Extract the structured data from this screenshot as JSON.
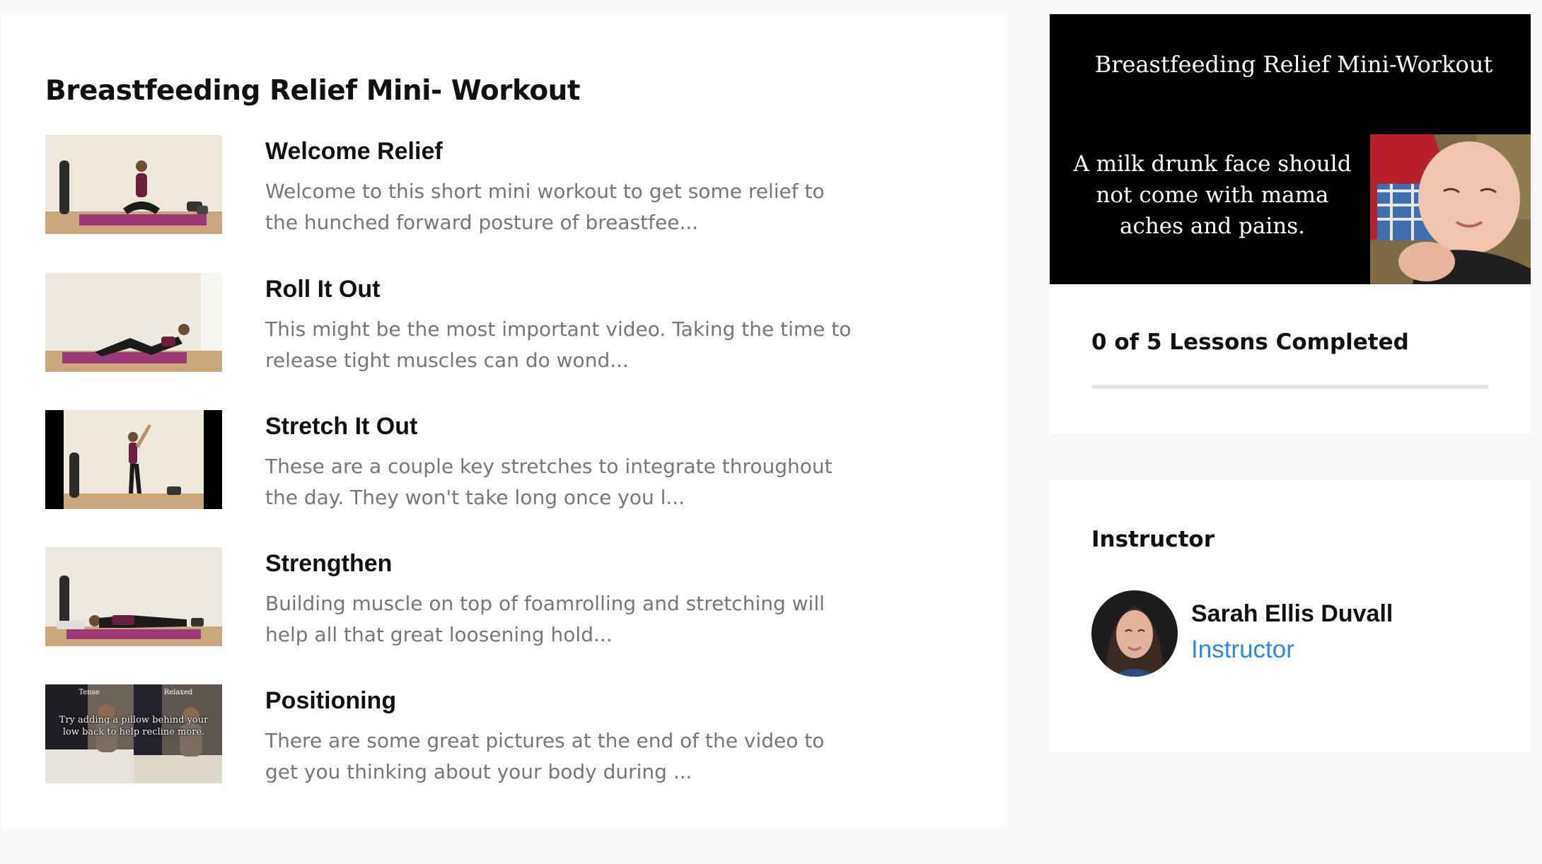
{
  "course": {
    "title": "Breastfeeding Relief Mini- Workout"
  },
  "lessons": [
    {
      "title": "Welcome Relief",
      "description": "Welcome to this short mini workout to get some relief to the hunched forward posture of breastfee..."
    },
    {
      "title": "Roll It Out",
      "description": "This might be the most important video. Taking the time to release tight muscles can do wond..."
    },
    {
      "title": "Stretch It Out",
      "description": "These are a couple key stretches to integrate throughout the day. They won't take long once you l..."
    },
    {
      "title": "Strengthen",
      "description": "Building muscle on top of foamrolling and stretching will help all that great loosening hold..."
    },
    {
      "title": "Positioning",
      "description": "There are some great pictures at the end of the video to get you thinking about your body during ...",
      "thumb_text": {
        "left_label": "Tense",
        "right_label": "Relaxed",
        "caption": "Try adding a pillow behind your low back to help recline more."
      }
    }
  ],
  "promo": {
    "title": "Breastfeeding Relief Mini-Workout",
    "text": "A milk drunk face should not come with mama aches and pains."
  },
  "progress": {
    "label": "0 of 5 Lessons Completed",
    "completed": 0,
    "total": 5,
    "accent_color": "#2b8ae0"
  },
  "instructor": {
    "heading": "Instructor",
    "name": "Sarah Ellis Duvall",
    "role": "Instructor",
    "role_color": "#2b8ae0"
  },
  "icons": {
    "thumbnails": "video-thumbnail-image",
    "avatar": "instructor-avatar-photo"
  }
}
